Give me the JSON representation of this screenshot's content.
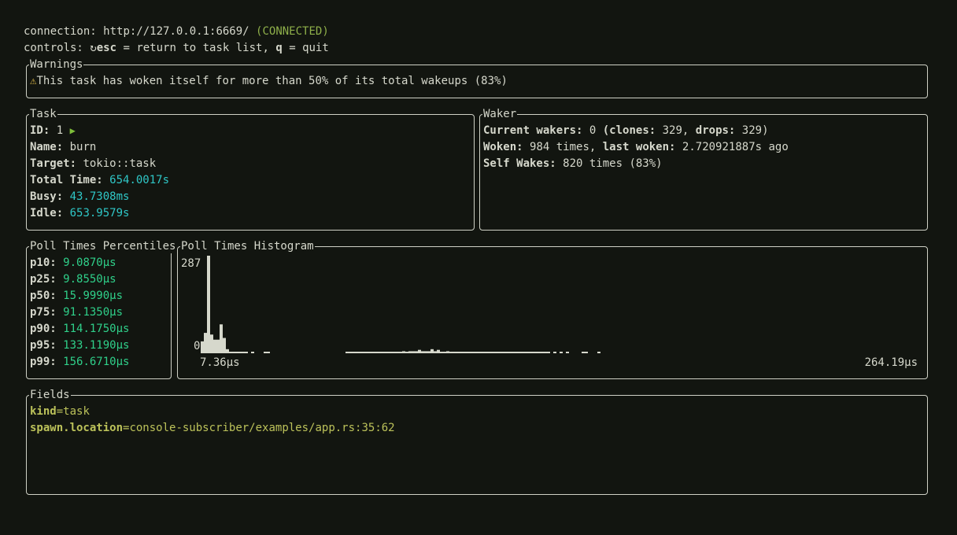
{
  "header": {
    "connection_label": "connection:",
    "connection_url": "http://127.0.0.1:6669/",
    "connection_status": "(CONNECTED)",
    "controls_label": "controls:",
    "controls_icon": "refresh-icon",
    "esc_key": "esc",
    "esc_desc": "= return to task list,",
    "q_key": "q",
    "q_desc": "= quit"
  },
  "warnings": {
    "title": "Warnings",
    "icon": "warning-icon",
    "message": "This task has woken itself for more than 50% of its total wakeups (83%)"
  },
  "task": {
    "title": "Task",
    "id_label": "ID:",
    "id_value": "1",
    "state_icon": "play-icon",
    "name_label": "Name:",
    "name_value": "burn",
    "target_label": "Target:",
    "target_value": "tokio::task",
    "total_label": "Total Time:",
    "total_value": "654.0017s",
    "busy_label": "Busy:",
    "busy_value": "43.7308ms",
    "idle_label": "Idle:",
    "idle_value": "653.9579s"
  },
  "waker": {
    "title": "Waker",
    "current_label": "Current wakers:",
    "current_value": "0",
    "clones_open": "(clones:",
    "clones_value": "329,",
    "drops_label": "drops:",
    "drops_value": "329)",
    "woken_label": "Woken:",
    "woken_value": "984 times,",
    "last_label": "last woken:",
    "last_value": "2.720921887s ago",
    "self_label": "Self Wakes:",
    "self_value": "820 times (83%)"
  },
  "percentiles": {
    "title": "Poll Times Percentiles",
    "items": [
      {
        "label": "p10:",
        "value": "9.0870µs"
      },
      {
        "label": "p25:",
        "value": "9.8550µs"
      },
      {
        "label": "p50:",
        "value": "15.9990µs"
      },
      {
        "label": "p75:",
        "value": "91.1350µs"
      },
      {
        "label": "p90:",
        "value": "114.1750µs"
      },
      {
        "label": "p95:",
        "value": "133.1190µs"
      },
      {
        "label": "p99:",
        "value": "156.6710µs"
      }
    ]
  },
  "histogram": {
    "title": "Poll Times Histogram",
    "y_max_label": "287",
    "y_min_label": "0",
    "x_min_label": "7.36µs",
    "x_max_label": "264.19µs",
    "bar_color": "#d6d8cc"
  },
  "fields": {
    "title": "Fields",
    "items": [
      {
        "key": "kind",
        "eq": "=",
        "value": "task"
      },
      {
        "key": "spawn.location",
        "eq": "=",
        "value": "console-subscriber/examples/app.rs:35:62"
      }
    ]
  },
  "chart_data": {
    "type": "bar",
    "title": "Poll Times Histogram",
    "xlabel": "",
    "ylabel": "",
    "ylim": [
      0,
      287
    ],
    "xlim_labels": [
      "7.36µs",
      "264.19µs"
    ],
    "values": [
      35,
      60,
      287,
      55,
      40,
      40,
      85,
      45,
      12,
      4,
      3,
      3,
      3,
      3,
      3,
      0,
      3,
      0,
      0,
      0,
      3,
      3,
      0,
      0,
      0,
      0,
      0,
      0,
      0,
      0,
      0,
      0,
      0,
      0,
      0,
      0,
      0,
      0,
      0,
      0,
      0,
      0,
      0,
      0,
      0,
      0,
      3,
      3,
      3,
      3,
      3,
      3,
      3,
      3,
      3,
      3,
      3,
      3,
      3,
      3,
      3,
      3,
      3,
      3,
      6,
      3,
      6,
      6,
      6,
      10,
      6,
      6,
      6,
      12,
      6,
      10,
      3,
      3,
      6,
      3,
      3,
      3,
      3,
      3,
      3,
      3,
      3,
      3,
      3,
      3,
      3,
      3,
      3,
      3,
      3,
      3,
      3,
      3,
      3,
      3,
      3,
      3,
      3,
      3,
      3,
      3,
      3,
      3,
      3,
      3,
      3,
      0,
      3,
      0,
      3,
      0,
      3,
      0,
      0,
      0,
      0,
      3,
      3,
      0,
      0,
      0,
      3,
      0,
      0,
      0,
      0,
      0,
      0,
      0,
      0,
      0,
      0,
      0,
      0,
      0,
      0,
      0,
      0,
      0,
      0,
      0,
      0,
      0,
      0,
      0,
      0,
      0,
      0,
      0,
      0,
      0,
      0,
      0,
      0,
      0,
      0,
      0,
      0,
      0,
      0,
      0,
      0,
      0,
      0,
      0,
      0,
      0,
      0,
      0,
      0,
      0,
      0,
      0
    ]
  }
}
